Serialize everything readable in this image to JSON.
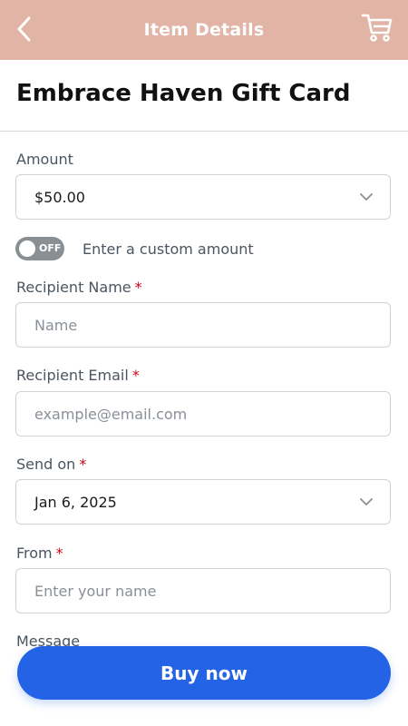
{
  "header": {
    "title": "Item Details",
    "back_icon": "chevron-left-icon",
    "cart_icon": "cart-icon",
    "background_color": "#e2b4a5"
  },
  "item": {
    "title": "Embrace Haven Gift Card"
  },
  "form": {
    "amount": {
      "label": "Amount",
      "value": "$50.00"
    },
    "custom_amount": {
      "toggle_state": "OFF",
      "label": "Enter a custom amount"
    },
    "recipient_name": {
      "label": "Recipient Name",
      "required_mark": "*",
      "placeholder": "Name"
    },
    "recipient_email": {
      "label": "Recipient Email",
      "required_mark": "*",
      "placeholder": "example@email.com"
    },
    "send_on": {
      "label": "Send on",
      "required_mark": "*",
      "value": "Jan 6, 2025"
    },
    "from": {
      "label": "From",
      "required_mark": "*",
      "placeholder": "Enter your name"
    },
    "message": {
      "label": "Message"
    }
  },
  "footer": {
    "buy_label": "Buy now",
    "button_color": "#2563e6"
  }
}
